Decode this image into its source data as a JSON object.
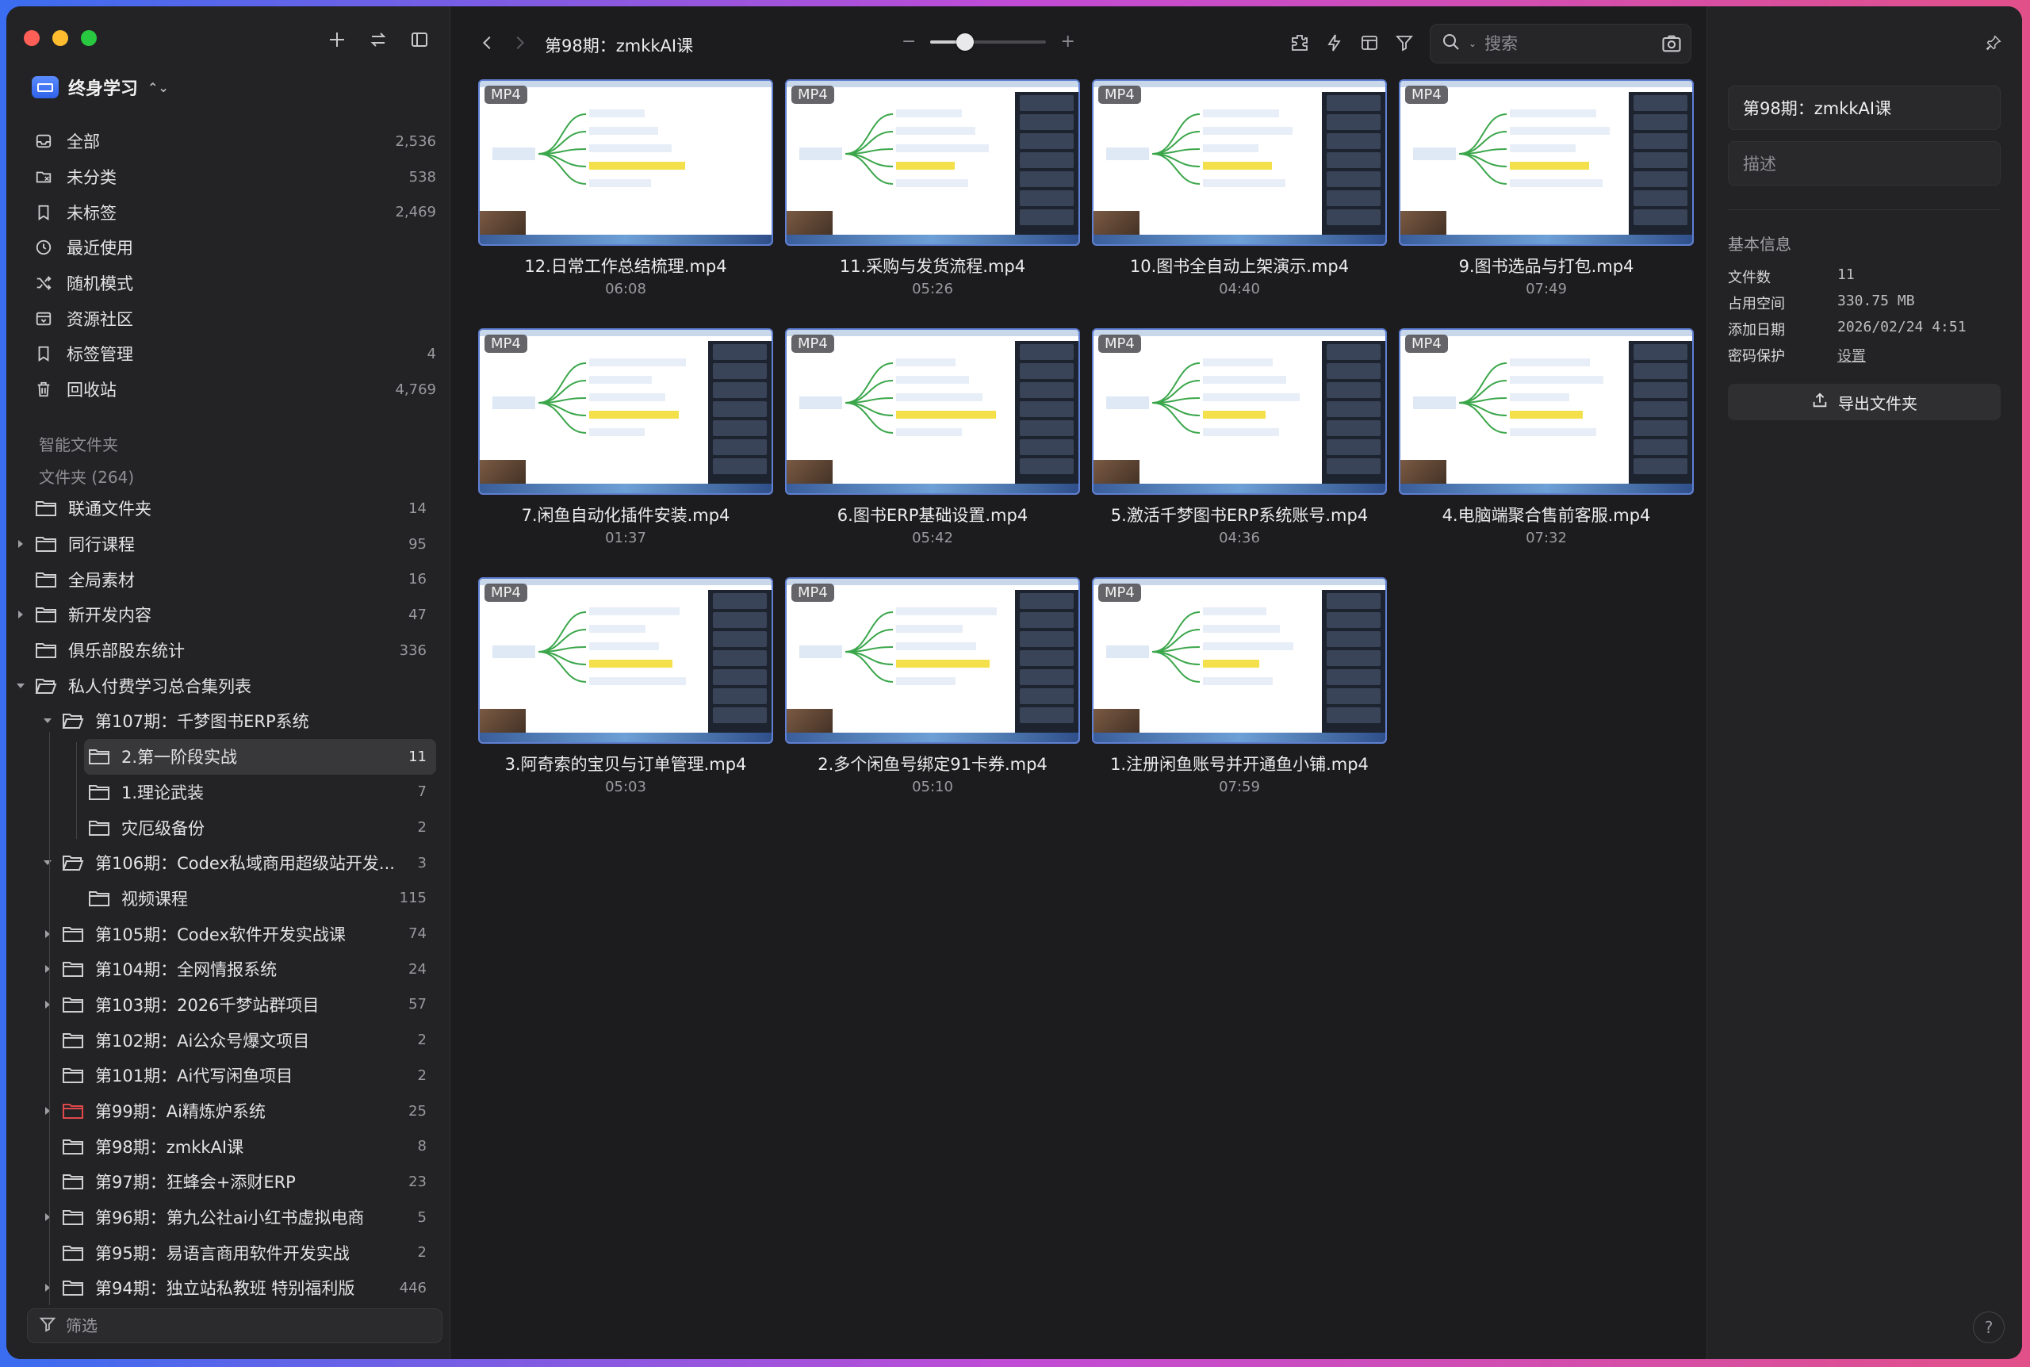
{
  "colors": {
    "accent": "#3d7bf7",
    "close": "#ff5f57",
    "minimize": "#febc2e",
    "zoom": "#28c840",
    "red_folder": "#e0494b"
  },
  "sidebar": {
    "library_name": "终身学习",
    "nav": [
      {
        "label": "全部",
        "count": "2,536",
        "icon": "inbox-icon"
      },
      {
        "label": "未分类",
        "count": "538",
        "icon": "uncategorized-icon"
      },
      {
        "label": "未标签",
        "count": "2,469",
        "icon": "untagged-icon"
      },
      {
        "label": "最近使用",
        "count": "",
        "icon": "clock-icon"
      },
      {
        "label": "随机模式",
        "count": "",
        "icon": "shuffle-icon"
      },
      {
        "label": "资源社区",
        "count": "",
        "icon": "community-icon"
      },
      {
        "label": "标签管理",
        "count": "4",
        "icon": "bookmark-icon"
      },
      {
        "label": "回收站",
        "count": "4,769",
        "icon": "trash-icon"
      }
    ],
    "smart_folders_label": "智能文件夹",
    "folders_label": "文件夹 (264)",
    "tree": [
      {
        "label": "联通文件夹",
        "count": "14",
        "level": 0,
        "chevron": "none"
      },
      {
        "label": "同行课程",
        "count": "95",
        "level": 0,
        "chevron": "right"
      },
      {
        "label": "全局素材",
        "count": "16",
        "level": 0,
        "chevron": "none"
      },
      {
        "label": "新开发内容",
        "count": "47",
        "level": 0,
        "chevron": "right"
      },
      {
        "label": "俱乐部股东统计",
        "count": "336",
        "level": 0,
        "chevron": "none"
      },
      {
        "label": "私人付费学习总合集列表",
        "count": "",
        "level": 0,
        "chevron": "down"
      },
      {
        "label": "第107期：千梦图书ERP系统",
        "count": "",
        "level": 1,
        "chevron": "down"
      },
      {
        "label": "2.第一阶段实战",
        "count": "11",
        "level": 2,
        "chevron": "none",
        "selected": true
      },
      {
        "label": "1.理论武装",
        "count": "7",
        "level": 2,
        "chevron": "none"
      },
      {
        "label": "灾厄级备份",
        "count": "2",
        "level": 2,
        "chevron": "none"
      },
      {
        "label": "第106期：Codex私域商用超级站开发...",
        "count": "3",
        "level": 1,
        "chevron": "down"
      },
      {
        "label": "视频课程",
        "count": "115",
        "level": 2,
        "chevron": "none"
      },
      {
        "label": "第105期：Codex软件开发实战课",
        "count": "74",
        "level": 1,
        "chevron": "right"
      },
      {
        "label": "第104期：全网情报系统",
        "count": "24",
        "level": 1,
        "chevron": "right"
      },
      {
        "label": "第103期：2026千梦站群项目",
        "count": "57",
        "level": 1,
        "chevron": "right"
      },
      {
        "label": "第102期：Ai公众号爆文项目",
        "count": "2",
        "level": 1,
        "chevron": "none"
      },
      {
        "label": "第101期：Ai代写闲鱼项目",
        "count": "2",
        "level": 1,
        "chevron": "none"
      },
      {
        "label": "第99期：Ai精炼炉系统",
        "count": "25",
        "level": 1,
        "chevron": "right",
        "red": true
      },
      {
        "label": "第98期：zmkkAI课",
        "count": "8",
        "level": 1,
        "chevron": "none"
      },
      {
        "label": "第97期：狂蜂会+添财ERP",
        "count": "23",
        "level": 1,
        "chevron": "none"
      },
      {
        "label": "第96期：第九公社ai小红书虚拟电商",
        "count": "5",
        "level": 1,
        "chevron": "right"
      },
      {
        "label": "第95期：易语言商用软件开发实战",
        "count": "2",
        "level": 1,
        "chevron": "none"
      },
      {
        "label": "第94期：独立站私教班 特别福利版",
        "count": "446",
        "level": 1,
        "chevron": "right"
      }
    ],
    "filter_placeholder": "筛选"
  },
  "toolbar": {
    "title": "第98期：zmkkAI课",
    "zoom_minus": "−",
    "zoom_plus": "+",
    "zoom_level": 0.3,
    "search_placeholder": "搜索"
  },
  "items": [
    {
      "badge": "MP4",
      "name": "12.日常工作总结梳理.mp4",
      "duration": "06:08"
    },
    {
      "badge": "MP4",
      "name": "11.采购与发货流程.mp4",
      "duration": "05:26"
    },
    {
      "badge": "MP4",
      "name": "10.图书全自动上架演示.mp4",
      "duration": "04:40"
    },
    {
      "badge": "MP4",
      "name": "9.图书选品与打包.mp4",
      "duration": "07:49"
    },
    {
      "badge": "MP4",
      "name": "7.闲鱼自动化插件安装.mp4",
      "duration": "01:37"
    },
    {
      "badge": "MP4",
      "name": "6.图书ERP基础设置.mp4",
      "duration": "05:42"
    },
    {
      "badge": "MP4",
      "name": "5.激活千梦图书ERP系统账号.mp4",
      "duration": "04:36"
    },
    {
      "badge": "MP4",
      "name": "4.电脑端聚合售前客服.mp4",
      "duration": "07:32"
    },
    {
      "badge": "MP4",
      "name": "3.阿奇索的宝贝与订单管理.mp4",
      "duration": "05:03"
    },
    {
      "badge": "MP4",
      "name": "2.多个闲鱼号绑定91卡券.mp4",
      "duration": "05:10"
    },
    {
      "badge": "MP4",
      "name": "1.注册闲鱼账号并开通鱼小铺.mp4",
      "duration": "07:59"
    }
  ],
  "inspector": {
    "title_value": "第98期：zmkkAI课",
    "description_placeholder": "描述",
    "section_title": "基本信息",
    "fields": [
      {
        "key": "文件数",
        "value": "11"
      },
      {
        "key": "占用空间",
        "value": "330.75 MB"
      },
      {
        "key": "添加日期",
        "value": "2026/02/24 4:51"
      },
      {
        "key": "密码保护",
        "value": "设置"
      }
    ],
    "export_label": "导出文件夹",
    "help_label": "?"
  }
}
